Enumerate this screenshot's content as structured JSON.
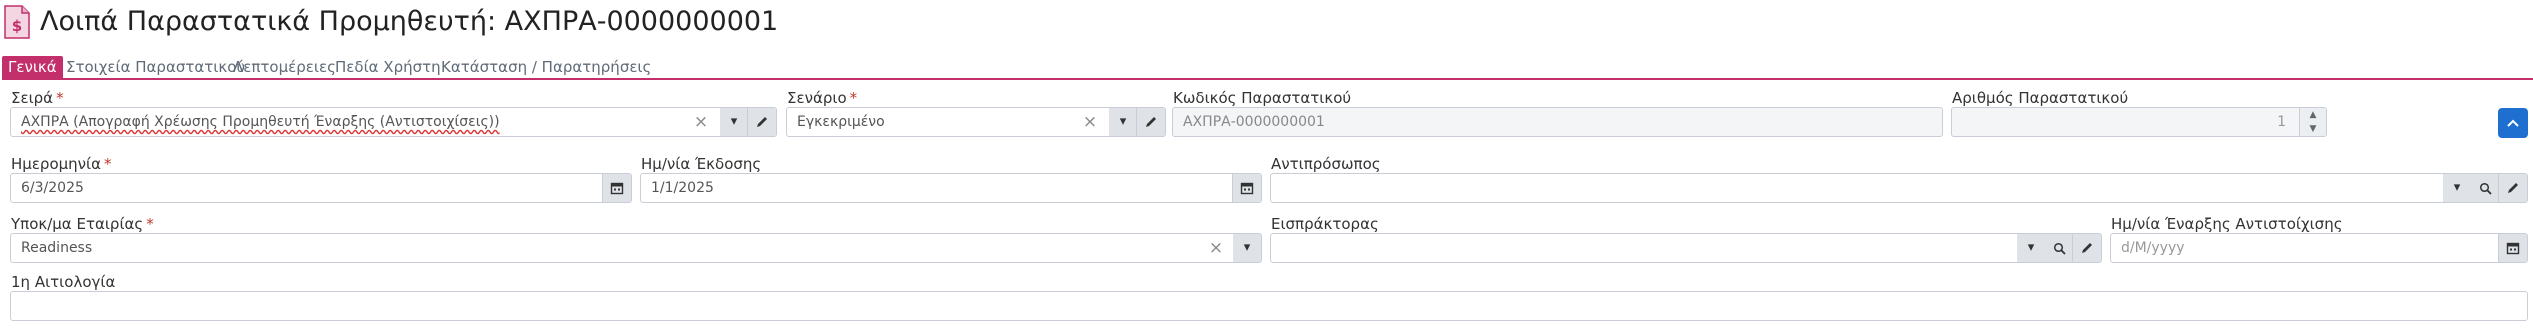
{
  "header": {
    "title": "Λοιπά Παραστατικά Προμηθευτή: ΑΧΠΡΑ-0000000001",
    "icon": "document-dollar-icon",
    "icon_symbol": "$"
  },
  "tabs": [
    {
      "label": "Γενικά",
      "active": true
    },
    {
      "label": "Στοιχεία Παραστατικού",
      "active": false
    },
    {
      "label": "Λεπτομέρειες",
      "active": false
    },
    {
      "label": "Πεδία Χρήστη",
      "active": false
    },
    {
      "label": "Κατάσταση / Παρατηρήσεις",
      "active": false
    }
  ],
  "form": {
    "series": {
      "label": "Σειρά",
      "value": "ΑΧΠΡΑ (Απογραφή Χρέωσης Προμηθευτή Έναρξης (Αντιστοιχίσεις))",
      "required": "*"
    },
    "scenario": {
      "label": "Σενάριο",
      "value": "Εγκεκριμένο",
      "required": "*"
    },
    "doc_code": {
      "label": "Κωδικός Παραστατικού",
      "value": "ΑΧΠΡΑ-0000000001"
    },
    "doc_number": {
      "label": "Αριθμός Παραστατικού",
      "value": "1"
    },
    "date": {
      "label": "Ημερομηνία",
      "value": "6/3/2025",
      "required": "*"
    },
    "issue_date": {
      "label": "Ημ/νία Έκδοσης",
      "value": "1/1/2025"
    },
    "representative": {
      "label": "Αντιπρόσωπος",
      "value": ""
    },
    "company_branch": {
      "label": "Υποκ/μα Εταιρίας",
      "value": "Readiness",
      "required": "*"
    },
    "collector": {
      "label": "Εισπράκτορας",
      "value": ""
    },
    "matching_start_date": {
      "label": "Ημ/νία Έναρξης Αντιστοίχισης",
      "placeholder": "d/M/yyyy"
    },
    "reason1": {
      "label": "1η Αιτιολογία",
      "value": ""
    }
  },
  "glyphs": {
    "clear": "×",
    "dropdown": "▾",
    "spin_up": "▲",
    "spin_down": "▼"
  },
  "colors": {
    "accent": "#c22f6b",
    "primary_button": "#1f6fd0",
    "required": "#c0392b"
  }
}
